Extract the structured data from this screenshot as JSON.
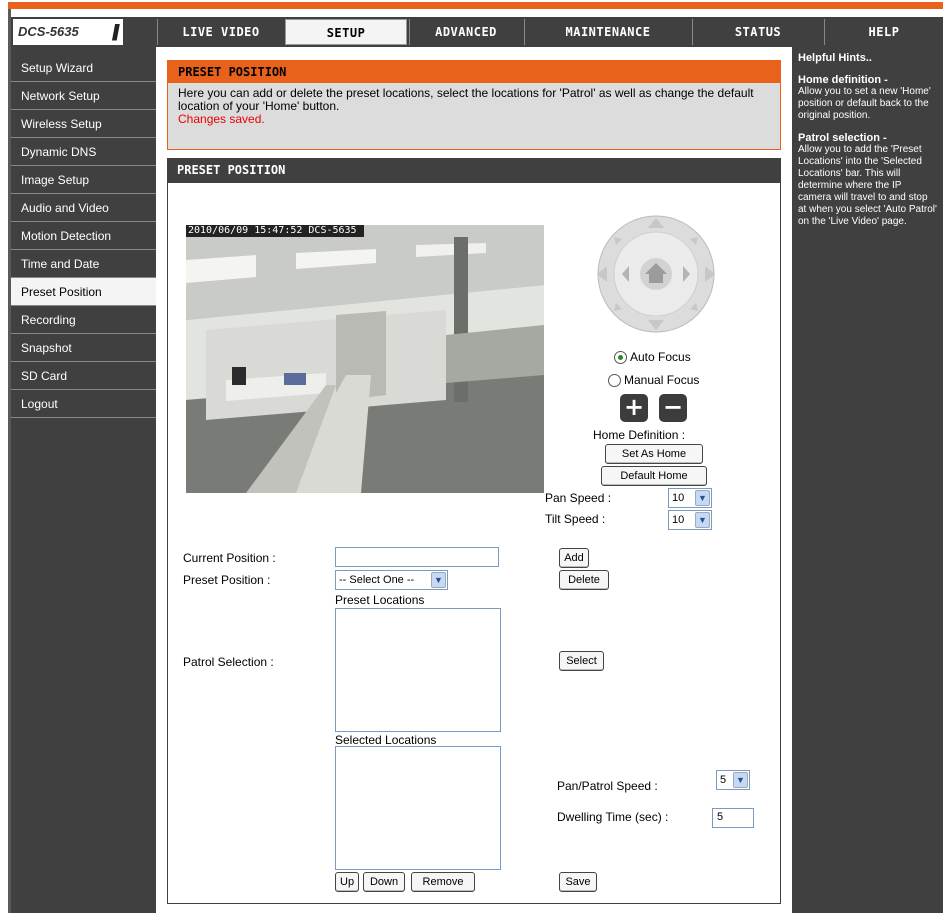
{
  "logo": {
    "text": "DCS-5635"
  },
  "tabs": [
    {
      "label": "LIVE VIDEO"
    },
    {
      "label": "SETUP"
    },
    {
      "label": "ADVANCED"
    },
    {
      "label": "MAINTENANCE"
    },
    {
      "label": "STATUS"
    },
    {
      "label": "HELP"
    }
  ],
  "sidebar": {
    "items": [
      {
        "label": "Setup Wizard"
      },
      {
        "label": "Network Setup"
      },
      {
        "label": "Wireless Setup"
      },
      {
        "label": "Dynamic DNS"
      },
      {
        "label": "Image Setup"
      },
      {
        "label": "Audio and Video"
      },
      {
        "label": "Motion Detection"
      },
      {
        "label": "Time and Date"
      },
      {
        "label": "Preset Position"
      },
      {
        "label": "Recording"
      },
      {
        "label": "Snapshot"
      },
      {
        "label": "SD Card"
      },
      {
        "label": "Logout"
      }
    ]
  },
  "intro": {
    "title": "PRESET POSITION",
    "text": "Here you can add or delete the preset locations, select the locations for 'Patrol' as well as change the default location of your 'Home' button.",
    "status": "Changes saved."
  },
  "preset": {
    "title": "PRESET POSITION",
    "camera_overlay": "2010/06/09 15:47:52 DCS-5635",
    "auto_focus": "Auto Focus",
    "manual_focus": "Manual Focus",
    "zoom_in": "+",
    "zoom_out": "−",
    "home_definition": "Home Definition :",
    "set_as_home": "Set As Home",
    "default_home": "Default Home",
    "pan_speed_label": "Pan Speed :",
    "pan_speed_value": "10",
    "tilt_speed_label": "Tilt Speed :",
    "tilt_speed_value": "10",
    "current_position_label": "Current Position :",
    "current_position_value": "",
    "add": "Add",
    "preset_position_label": "Preset Position :",
    "preset_position_value": "-- Select One --",
    "delete": "Delete",
    "preset_locations_label": "Preset Locations",
    "patrol_selection_label": "Patrol Selection :",
    "select": "Select",
    "selected_locations_label": "Selected Locations",
    "pan_patrol_speed_label": "Pan/Patrol Speed :",
    "pan_patrol_speed_value": "5",
    "dwelling_time_label": "Dwelling Time (sec) :",
    "dwelling_time_value": "5",
    "up": "Up",
    "down": "Down",
    "remove": "Remove",
    "save": "Save"
  },
  "help": {
    "title": "Helpful Hints..",
    "home_title": "Home definition -",
    "home_text": "Allow you to set a new 'Home' position or default back to the original position.",
    "patrol_title": "Patrol selection -",
    "patrol_text": "Allow you to add the 'Preset Locations' into the 'Selected Locations' bar. This will determine where the IP camera will travel to and stop at when you select 'Auto Patrol' on the 'Live Video' page."
  }
}
